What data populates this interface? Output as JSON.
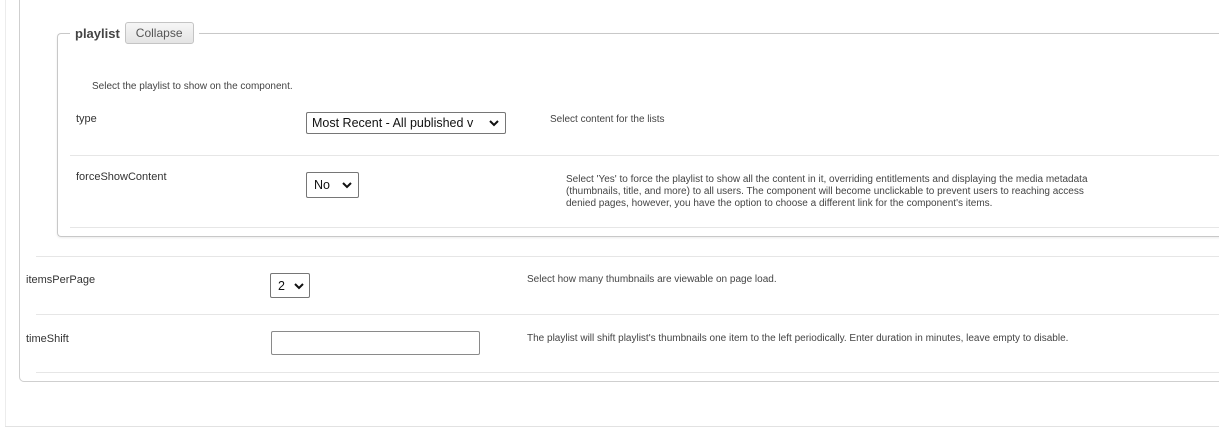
{
  "playlist": {
    "legend_title": "playlist",
    "collapse_label": "Collapse",
    "intro": "Select the playlist to show on the component.",
    "fields": {
      "type": {
        "label": "type",
        "selected": "Most Recent - All published v",
        "description": "Select content for the lists"
      },
      "forceShowContent": {
        "label": "forceShowContent",
        "selected": "No",
        "description_lines": [
          "Select 'Yes' to force the playlist to show all the content in it, overriding entitlements and displaying the media metadata",
          "(thumbnails, title, and more) to all users. The component will become unclickable to prevent users to reaching access",
          "denied pages, however, you have the option to choose a different link for the component's items."
        ]
      }
    }
  },
  "fields": {
    "itemsPerPage": {
      "label": "itemsPerPage",
      "selected": "2",
      "description": "Select how many thumbnails are viewable on page load."
    },
    "timeShift": {
      "label": "timeShift",
      "value": "",
      "description": "The playlist will shift playlist's thumbnails one item to the left periodically. Enter duration in minutes, leave empty to disable."
    }
  },
  "icons": {
    "select_chevron": "chevron-down-icon"
  }
}
